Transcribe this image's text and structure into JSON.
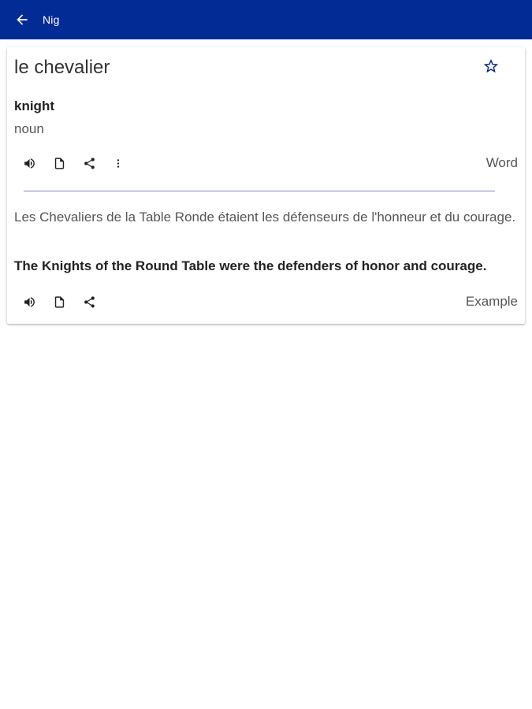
{
  "appbar": {
    "title": "Nig",
    "back_icon": "arrow-left-icon",
    "color": "#022b95"
  },
  "entry": {
    "headword": "le chevalier",
    "translation": "knight",
    "part_of_speech": "noun",
    "favorite_icon": "star-outline-icon",
    "word_tag": "Word",
    "word_actions": [
      "speaker-icon",
      "copy-icon",
      "share-icon",
      "more-vert-icon"
    ]
  },
  "example": {
    "french": "Les Chevaliers de la Table Ronde étaient les défenseurs de l'honneur et du courage.",
    "english": "The Knights of the Round Table were the defenders of honor and courage.",
    "tag": "Example",
    "actions": [
      "speaker-icon",
      "copy-icon",
      "share-icon"
    ]
  }
}
